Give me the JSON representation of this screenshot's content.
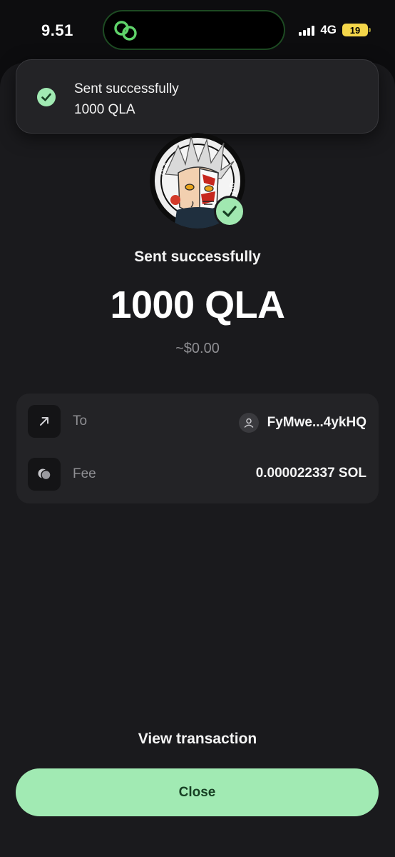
{
  "status_bar": {
    "time": "9.51",
    "network": "4G",
    "battery": "19"
  },
  "toast": {
    "line1": "Sent successfully",
    "line2": "1000 QLA"
  },
  "result": {
    "title": "Sent successfully",
    "amount": "1000 QLA",
    "usd_value": "~$0.00"
  },
  "details": {
    "to_label": "To",
    "to_value": "FyMwe...4ykHQ",
    "fee_label": "Fee",
    "fee_value": "0.000022337 SOL"
  },
  "actions": {
    "view_transaction": "View transaction",
    "close": "Close"
  },
  "colors": {
    "accent_green": "#a1eab3",
    "background": "#0d0d0f",
    "sheet": "#1a1a1d",
    "card": "#232326"
  }
}
